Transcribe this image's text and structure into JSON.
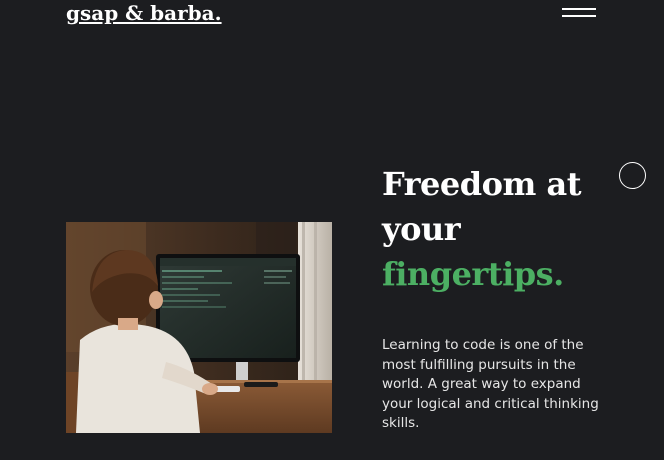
{
  "header": {
    "logo_text": "gsap & barba.",
    "menu_icon": "hamburger-menu-icon"
  },
  "cursor": {
    "icon": "cursor-circle-icon"
  },
  "hero": {
    "image_alt": "Child coding at a desk in front of a computer monitor",
    "headline_line1": "Freedom at",
    "headline_line2": "your",
    "headline_line3": "fingertips.",
    "body": "Learning to code is one of the most fulfilling pursuits in the world. A great way to expand your logical and critical thinking skills."
  },
  "colors": {
    "background": "#1c1d20",
    "text": "#ffffff",
    "accent": "#4caf63"
  }
}
